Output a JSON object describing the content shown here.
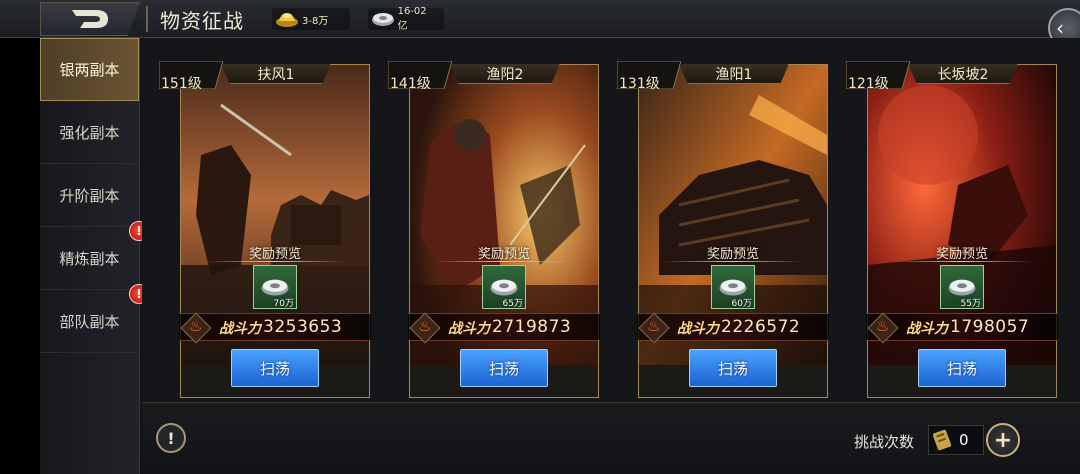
{
  "header": {
    "title": "物资征战",
    "gold_value": "3-8万",
    "silver_value": "16-02亿"
  },
  "sidebar": {
    "items": [
      {
        "label": "银两副本",
        "active": true,
        "alert": false
      },
      {
        "label": "强化副本",
        "active": false,
        "alert": false
      },
      {
        "label": "升阶副本",
        "active": false,
        "alert": false
      },
      {
        "label": "精炼副本",
        "active": false,
        "alert": true
      },
      {
        "label": "部队副本",
        "active": false,
        "alert": true
      }
    ],
    "alert_glyph": "!"
  },
  "cards": [
    {
      "level": "151级",
      "name": "扶风1",
      "reward_label": "奖励预览",
      "reward_amount": "70万",
      "power_label": "战斗力",
      "power_value": "3253653",
      "button_label": "扫荡"
    },
    {
      "level": "141级",
      "name": "渔阳2",
      "reward_label": "奖励预览",
      "reward_amount": "65万",
      "power_label": "战斗力",
      "power_value": "2719873",
      "button_label": "扫荡"
    },
    {
      "level": "131级",
      "name": "渔阳1",
      "reward_label": "奖励预览",
      "reward_amount": "60万",
      "power_label": "战斗力",
      "power_value": "2226572",
      "button_label": "扫荡"
    },
    {
      "level": "121级",
      "name": "长坂坡2",
      "reward_label": "奖励预览",
      "reward_amount": "55万",
      "power_label": "战斗力",
      "power_value": "1798057",
      "button_label": "扫荡"
    }
  ],
  "footer": {
    "info_glyph": "!",
    "challenge_label": "挑战次数",
    "challenge_count": "0",
    "add_glyph": "+"
  },
  "icons": {
    "back": "back-logo-icon",
    "gold": "gold-ingot-icon",
    "silver": "silver-coin-icon",
    "collapse": "collapse-arrow-icon",
    "reward": "silver-coin-icon",
    "power": "fire-icon",
    "challenge": "scroll-token-icon"
  },
  "colors": {
    "accent_gold": "#a38755",
    "button_blue": "#1d63d2",
    "alert_red": "#b3120c",
    "reward_green": "#2f6a3a"
  }
}
